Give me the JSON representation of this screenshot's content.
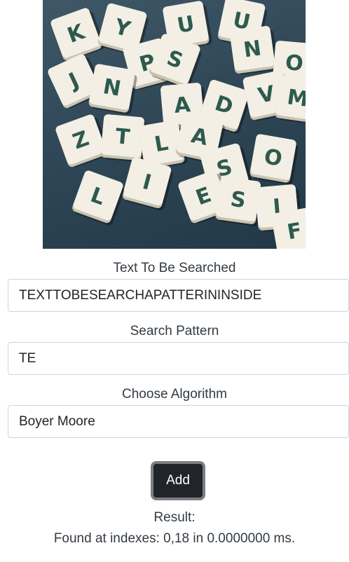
{
  "hero_image": {
    "icon": "scrabble-tiles-image",
    "tiles": [
      "K",
      "Y",
      "U",
      "U",
      "N",
      "P",
      "S",
      "O",
      "J",
      "N",
      "A",
      "D",
      "V",
      "M",
      "Z",
      "T",
      "L",
      "A",
      "S",
      "O",
      "I",
      "E",
      "S",
      "I",
      "L",
      "F"
    ]
  },
  "form": {
    "text_label": "Text To Be Searched",
    "text_value": "TEXTTOBESEARCHAPATTERININSIDE",
    "pattern_label": "Search Pattern",
    "pattern_value": "TE",
    "algorithm_label": "Choose Algorithm",
    "algorithm_value": "Boyer Moore",
    "add_label": "Add"
  },
  "result": {
    "label": "Result:",
    "text": "Found at indexes: 0,18 in 0.0000000 ms."
  },
  "colors": {
    "button_bg": "#212529",
    "button_border": "#7a7f84",
    "tile": "#f3efe4",
    "tile_letter": "#2d5a4e",
    "background_image": "#2f4757"
  }
}
